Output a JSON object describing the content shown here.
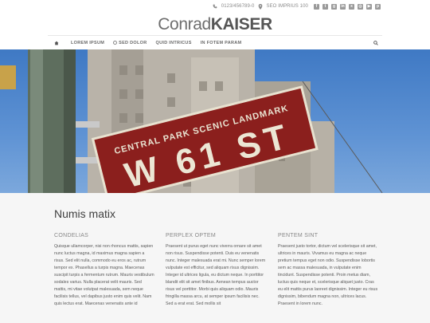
{
  "topbar": {
    "phone": "0123/456789-0",
    "address": "SEO IMPRIUS 100",
    "social_icons": [
      "facebook-icon",
      "twitter-icon",
      "google-plus-icon",
      "linkedin-icon",
      "xing-icon",
      "instagram-icon",
      "youtube-icon",
      "pinterest-icon"
    ]
  },
  "logo": {
    "first": "Conrad",
    "last": "KAISER"
  },
  "nav": {
    "items": [
      {
        "label": "LOREM IPSUM"
      },
      {
        "label": "SED DOLOR"
      },
      {
        "label": "QUID INTRICUS"
      },
      {
        "label": "IN FOTEM PARAM"
      }
    ]
  },
  "hero": {
    "sign_main": "W 61 ST",
    "sign_sub": "CENTRAL PARK SCENIC LANDMARK"
  },
  "content": {
    "title": "Numis matix",
    "columns": [
      {
        "heading": "CONDELIAS",
        "text": "Quisque ullamcorper, nisi non rhoncus mattis, sapien nunc luctus magna, id maximus magna sapien a risus. Sed elit nulla, commodo eu eros ac, rutrum tempor ex. Phasellus a turpis magna. Maecenas suscipit turpis a fermentum rutrum. Mauris vestibulum sodales varius. Nulla placerat velit mauris. Sed mattis, mi vitae volutpat malesuada, sem neque facilisis tellus, vel dapibus justo enim quis velit. Nam quis lectus erat. Maecenas venenatis ante id"
      },
      {
        "heading": "PERPLEX OPTEM",
        "text": "Praesent ut purus eget nunc viverra ornare sit amet non risus. Suspendisse potenti. Duis eu venenatis nunc. Integer malesuada erat mi. Nunc semper lorem vulputate est efficitur, sed aliquam risus dignissim. Integer id ultrices ligula, eu dictum neque. In porttitor blandit elit sit amet finibus. Aenean tempus auctor risus vel porttitor. Morbi quis aliquam odio. Mauris fringilla massa arcu, at semper ipsum facilisis nec. Sed a erat erat. Sed mollis sit"
      },
      {
        "heading": "PENTEM SINT",
        "text": "Praesent justo tortor, dictum vel scelerisque sit amet, ultrices in mauris. Vivamus eu magna ac neque pretium tempus eget non odio. Suspendisse lobortis sem ac massa malesuada, in vulputate enim tincidunt. Suspendisse potenti. Proin metus diam, luctus quis neque et, scelerisque aliquet justo. Cras eu elit mattis purus laoreet dignissim. Integer eu risus dignissim, bibendum magna non, ultrices lacus. Praesent in lorem nunc."
      }
    ]
  }
}
